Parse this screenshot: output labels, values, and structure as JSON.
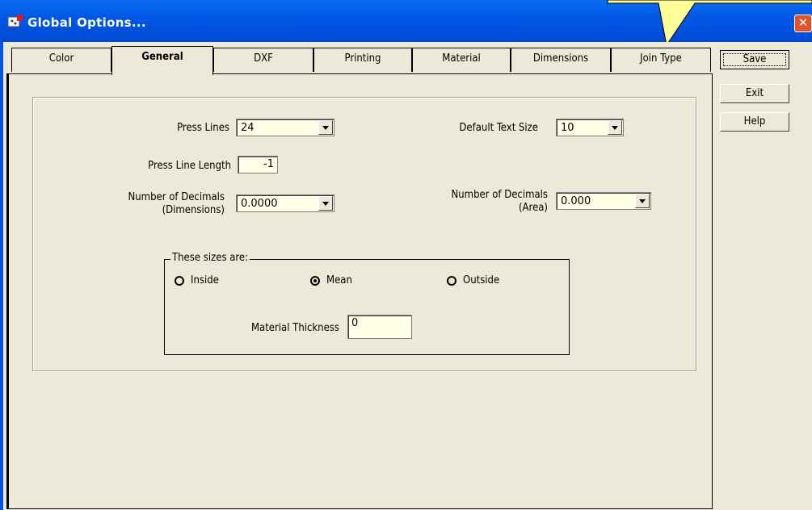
{
  "window": {
    "title": "Global Options...",
    "close_glyph": "✕",
    "icon": "app-icon"
  },
  "tabs": [
    {
      "label": "Color",
      "active": false
    },
    {
      "label": "General",
      "active": true
    },
    {
      "label": "DXF",
      "active": false
    },
    {
      "label": "Printing",
      "active": false
    },
    {
      "label": "Material",
      "active": false
    },
    {
      "label": "Dimensions",
      "active": false
    },
    {
      "label": "Join Type",
      "active": false
    }
  ],
  "buttons": {
    "save": "Save",
    "exit": "Exit",
    "help": "Help"
  },
  "general": {
    "press_lines_label": "Press Lines",
    "press_lines_value": "24",
    "default_text_size_label": "Default Text Size",
    "default_text_size_value": "10",
    "press_line_length_label": "Press Line Length",
    "press_line_length_value": "-1",
    "decimals_dim_label_1": "Number of Decimals",
    "decimals_dim_label_2": "(Dimensions)",
    "decimals_dim_value": "0.0000",
    "decimals_area_label_1": "Number of Decimals",
    "decimals_area_label_2": "(Area)",
    "decimals_area_value": "0.000"
  },
  "sizes": {
    "legend": "These sizes are:",
    "options": [
      {
        "label": "Inside",
        "selected": false
      },
      {
        "label": "Mean",
        "selected": true
      },
      {
        "label": "Outside",
        "selected": false
      }
    ],
    "thickness_label": "Material Thickness",
    "thickness_value": "0"
  },
  "colors": {
    "titlebar": "#0058e6",
    "client": "#ece9d8",
    "input_bg": "#ffffe8",
    "close": "#e0532a",
    "callout": "#ffff99"
  }
}
